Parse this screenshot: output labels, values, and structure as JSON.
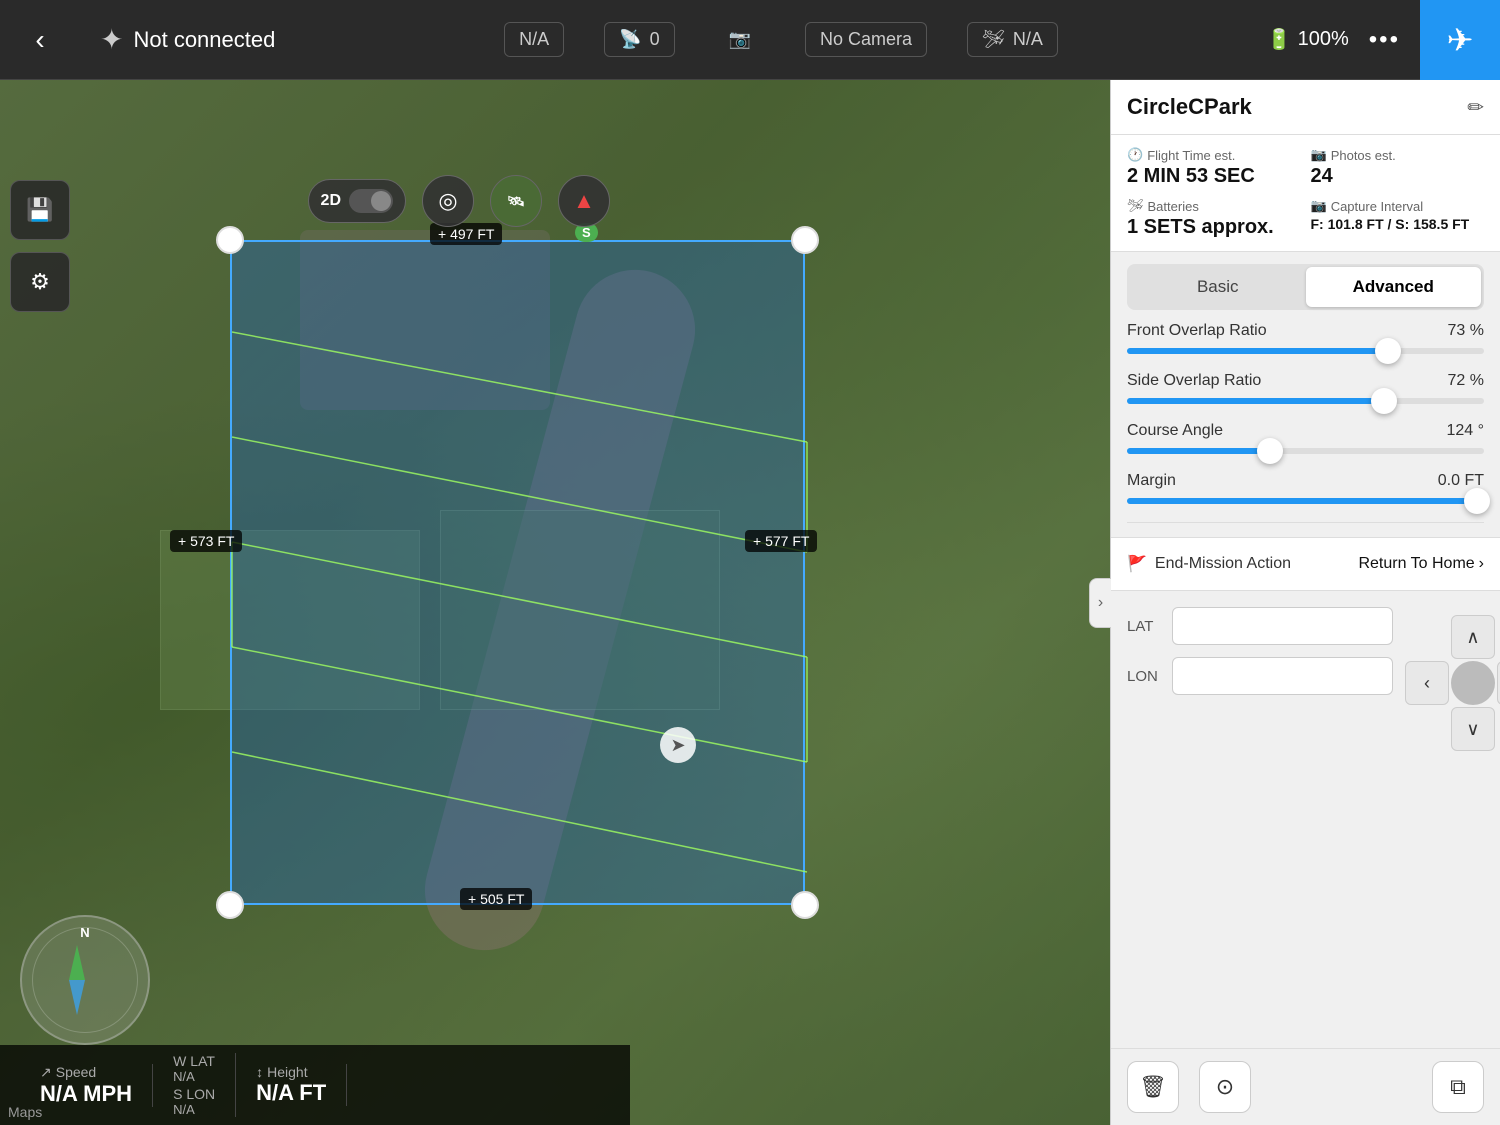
{
  "topbar": {
    "back_label": "‹",
    "not_connected": "Not connected",
    "signal_value": "N/A",
    "rc_signal": "0",
    "camera_label": "No Camera",
    "airspace_label": "N/A",
    "battery_label": "100%",
    "more_label": "•••",
    "fly_icon": "✈"
  },
  "map_controls": {
    "toggle_label": "2D",
    "target_icon": "◎",
    "compass_icon": "⊕"
  },
  "left_toolbar": {
    "save_icon": "💾",
    "settings_icon": "⚙"
  },
  "mission_waypoints": {
    "top_label": "+ 497 FT",
    "start_label": "S",
    "left_label": "+ 573 FT",
    "right_label": "+ 577 FT",
    "bottom_label": "+ 505 FT"
  },
  "panel": {
    "title": "CircleCPark",
    "edit_icon": "✏",
    "collapse_icon": "›",
    "flight_time_label": "Flight Time est.",
    "flight_time_value": "2 MIN 53 SEC",
    "photos_label": "Photos est.",
    "photos_value": "24",
    "batteries_label": "Batteries",
    "batteries_value": "1 SETS approx.",
    "capture_label": "Capture Interval",
    "capture_value": "F: 101.8 FT / S: 158.5 FT",
    "tab_basic": "Basic",
    "tab_advanced": "Advanced",
    "front_overlap_label": "Front Overlap Ratio",
    "front_overlap_value": "73 %",
    "front_overlap_pct": 73,
    "side_overlap_label": "Side Overlap Ratio",
    "side_overlap_value": "72 %",
    "side_overlap_pct": 72,
    "course_angle_label": "Course Angle",
    "course_angle_value": "124 °",
    "course_angle_pct": 40,
    "margin_label": "Margin",
    "margin_value": "0.0 FT",
    "margin_pct": 98,
    "end_mission_label": "End-Mission Action",
    "end_mission_value": "Return To Home",
    "lat_label": "LAT",
    "lon_label": "LON",
    "delete_icon": "🗑",
    "waypoint_icon": "⊙",
    "map_icon": "⧉"
  },
  "bottom_bar": {
    "speed_label": "Speed",
    "speed_value": "N/A MPH",
    "lat_label": "LAT",
    "lat_value": "N/A",
    "lon_label": "LON",
    "lon_value": "N/A",
    "height_label": "Height",
    "height_value": "N/A FT",
    "maps_label": "Maps"
  },
  "compass": {
    "north_label": "N"
  }
}
